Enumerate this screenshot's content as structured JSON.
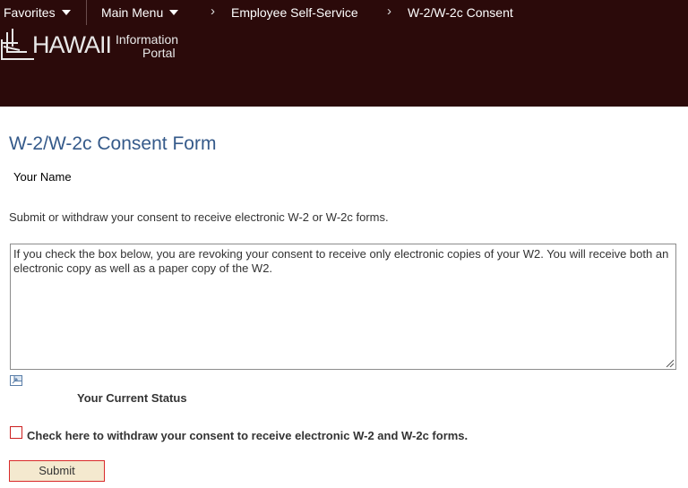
{
  "nav": {
    "favorites": "Favorites",
    "main_menu": "Main Menu",
    "breadcrumb_1": "Employee Self-Service",
    "breadcrumb_2": "W-2/W-2c Consent"
  },
  "logo": {
    "name": "HAWAII",
    "sub_line1": "Information",
    "sub_line2": "Portal"
  },
  "page": {
    "title": "W-2/W-2c Consent Form",
    "your_name": "Your Name",
    "instructions": "Submit or withdraw your consent to receive electronic W-2 or W-2c forms.",
    "consent_text": "If you check the box below, you are revoking your consent to receive only electronic copies of your W2. You will receive both an electronic copy as well as a paper copy of the W2.",
    "status_label": "Your Current Status",
    "checkbox_label": "Check here to withdraw your consent to receive electronic W-2 and W-2c forms.",
    "submit_label": "Submit"
  },
  "colors": {
    "header_bg": "#2b0a0a",
    "title": "#355a8a",
    "highlight_border": "#d92a2a",
    "button_bg": "#f4e9cf"
  },
  "icons": {
    "dropdown": "caret-down-icon",
    "breadcrumb_sep": "chevron-right-icon",
    "expand": "expand-icon",
    "resize": "resize-grip-icon"
  }
}
